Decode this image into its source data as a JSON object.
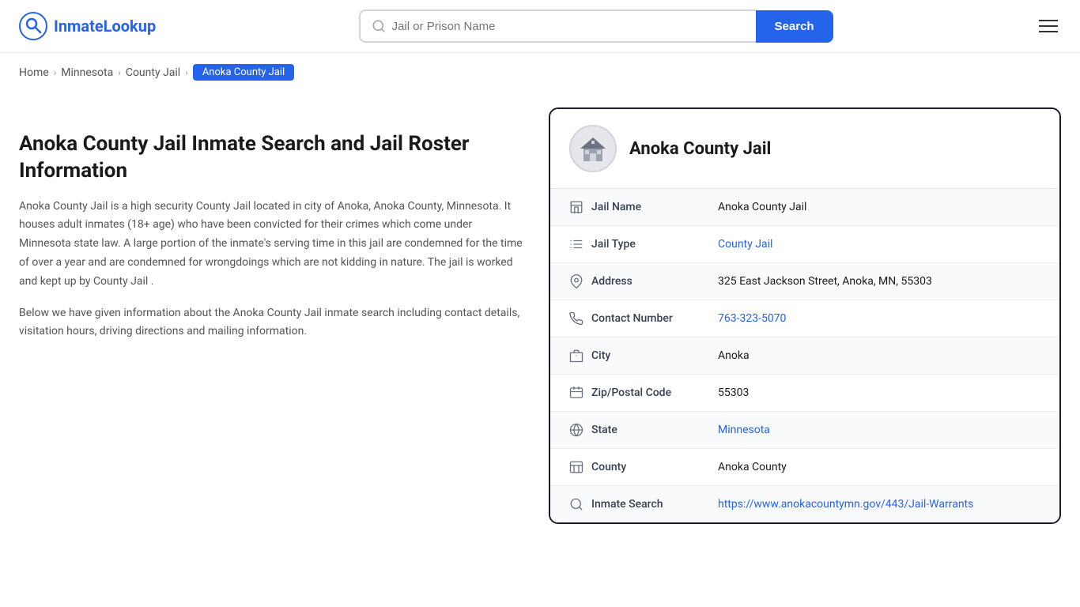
{
  "header": {
    "logo_text_prefix": "Inmate",
    "logo_text_suffix": "Lookup",
    "search_placeholder": "Jail or Prison Name",
    "search_button_label": "Search"
  },
  "breadcrumb": {
    "items": [
      "Home",
      "Minnesota",
      "County Jail"
    ],
    "active": "Anoka County Jail"
  },
  "left": {
    "page_title": "Anoka County Jail Inmate Search and Jail Roster Information",
    "description1": "Anoka County Jail is a high security County Jail located in city of Anoka, Anoka County, Minnesota. It houses adult inmates (18+ age) who have been convicted for their crimes which come under Minnesota state law. A large portion of the inmate's serving time in this jail are condemned for the time of over a year and are condemned for wrongdoings which are not kidding in nature. The jail is worked and kept up by County Jail .",
    "description2": "Below we have given information about the Anoka County Jail inmate search including contact details, visitation hours, driving directions and mailing information."
  },
  "card": {
    "title": "Anoka County Jail",
    "rows": [
      {
        "icon": "building-icon",
        "label": "Jail Name",
        "value": "Anoka County Jail",
        "link": null
      },
      {
        "icon": "list-icon",
        "label": "Jail Type",
        "value": "County Jail",
        "link": "#"
      },
      {
        "icon": "location-icon",
        "label": "Address",
        "value": "325 East Jackson Street, Anoka, MN, 55303",
        "link": null
      },
      {
        "icon": "phone-icon",
        "label": "Contact Number",
        "value": "763-323-5070",
        "link": "tel:763-323-5070"
      },
      {
        "icon": "city-icon",
        "label": "City",
        "value": "Anoka",
        "link": null
      },
      {
        "icon": "zip-icon",
        "label": "Zip/Postal Code",
        "value": "55303",
        "link": null
      },
      {
        "icon": "globe-icon",
        "label": "State",
        "value": "Minnesota",
        "link": "#"
      },
      {
        "icon": "county-icon",
        "label": "County",
        "value": "Anoka County",
        "link": null
      },
      {
        "icon": "search-icon",
        "label": "Inmate Search",
        "value": "https://www.anokacountymn.gov/443/Jail-Warrants",
        "link": "https://www.anokacountymn.gov/443/Jail-Warrants"
      }
    ]
  }
}
